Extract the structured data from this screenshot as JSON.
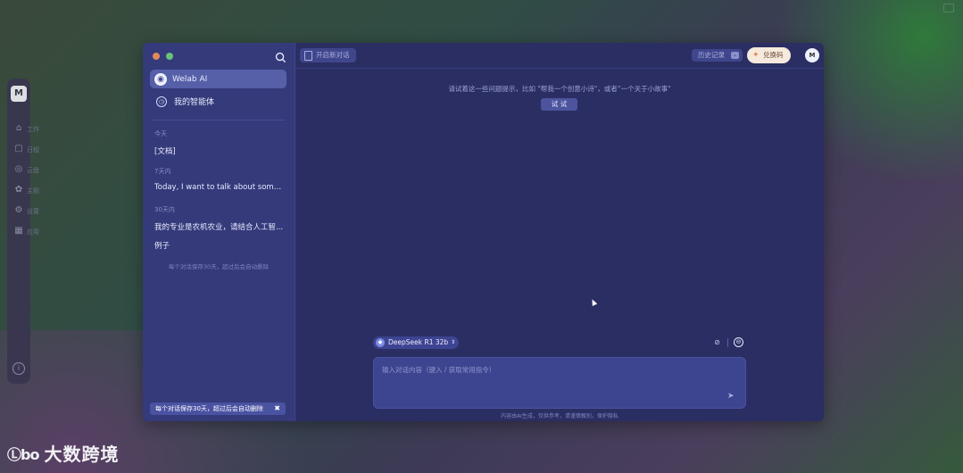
{
  "dock": {
    "logo": "M",
    "items": [
      {
        "icon": "home-icon",
        "glyph": "⌂",
        "label": "工作"
      },
      {
        "icon": "calendar-icon",
        "glyph": "▢",
        "label": "日程"
      },
      {
        "icon": "camera-icon",
        "glyph": "◎",
        "label": "云盘"
      },
      {
        "icon": "palette-icon",
        "glyph": "✿",
        "label": "主题"
      },
      {
        "icon": "settings-icon",
        "glyph": "⚙",
        "label": "设置"
      },
      {
        "icon": "apps-icon",
        "glyph": "▦",
        "label": "应用"
      }
    ],
    "info_glyph": "i"
  },
  "sidebar": {
    "nav": [
      {
        "label": "Welab AI",
        "glyph": "◉",
        "active": true
      },
      {
        "label": "我的智能体",
        "glyph": "◷",
        "active": false
      }
    ],
    "groups": [
      {
        "label": "今天",
        "items": [
          "[文档]"
        ]
      },
      {
        "label": "7天内",
        "items": [
          "Today, I want to talk about somethi..."
        ]
      },
      {
        "label": "30天内",
        "items": [
          "我的专业是农机农业，请结合人工智...",
          "例子"
        ]
      }
    ],
    "note": "每个对话保存30天，超过后会自动删除",
    "footer": "每个对话保存30天，超过后会自动删除",
    "footer_close": "✖"
  },
  "topbar": {
    "new_chat_label": "开启新对话",
    "dropdown_label": "历史记录",
    "dropdown_chevron": "⌄",
    "ticket_label": "兑换码",
    "ticket_glyph": "✦",
    "avatar": "M"
  },
  "main": {
    "hint": "请试着这一些问题提示，比如 \"帮我一个创意小诗\"，或者“一个关于小故事\"",
    "try_button": "试 试",
    "model": "DeepSeek R1 32b",
    "model_glyph": "◆",
    "model_arrow": "⇕",
    "tool_icons": {
      "attach": "⊘",
      "new": "⊖"
    },
    "input_placeholder": "输入对话内容（键入 / 获取常用指令）",
    "input_value": "",
    "send_glyph": "➤",
    "disclaimer": "内容由AI生成，仅供参考，请谨慎甄别，保护隐私"
  },
  "watermark": {
    "mark": "Ⓛbo",
    "text": "大数跨境"
  }
}
